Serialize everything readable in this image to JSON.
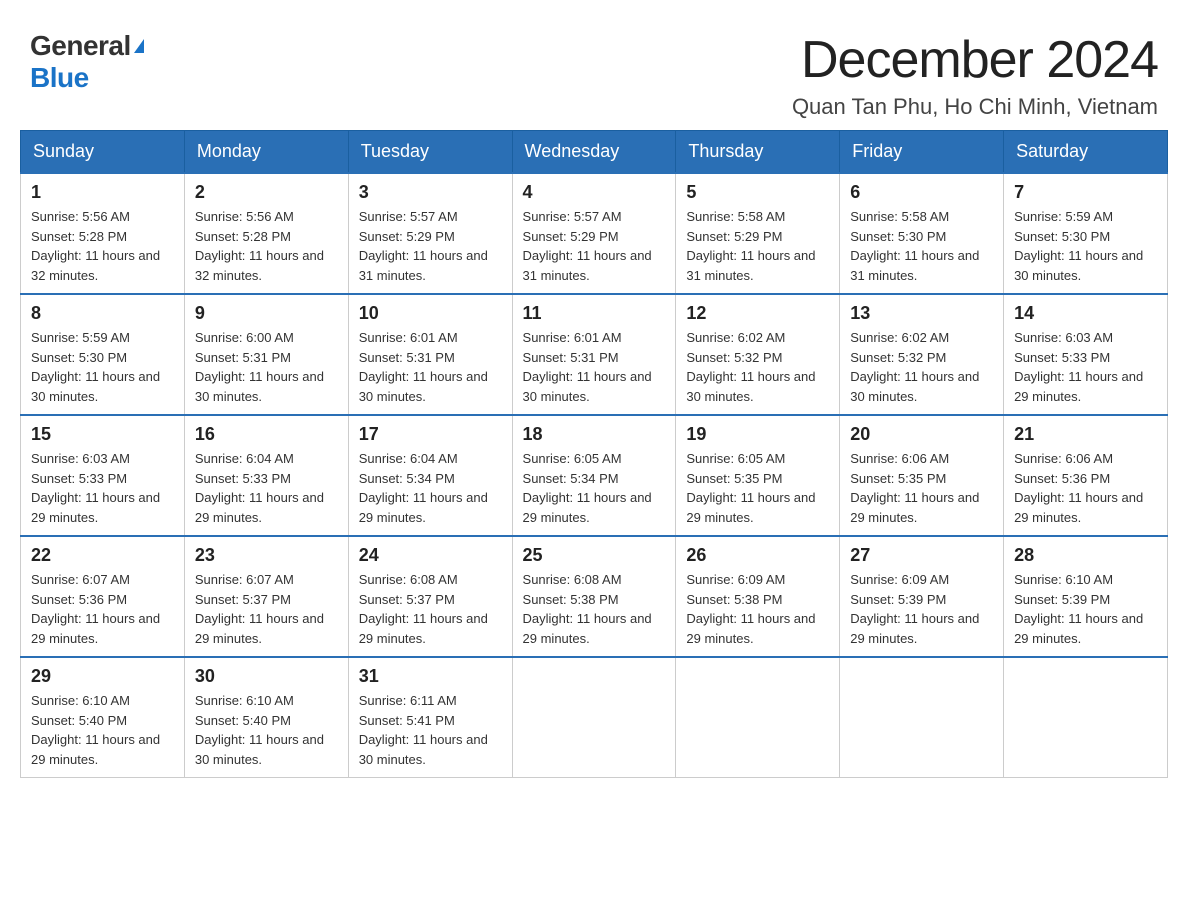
{
  "header": {
    "logo_general": "General",
    "logo_blue": "Blue",
    "title": "December 2024",
    "subtitle": "Quan Tan Phu, Ho Chi Minh, Vietnam"
  },
  "days_of_week": [
    "Sunday",
    "Monday",
    "Tuesday",
    "Wednesday",
    "Thursday",
    "Friday",
    "Saturday"
  ],
  "weeks": [
    [
      {
        "day": "1",
        "sunrise": "Sunrise: 5:56 AM",
        "sunset": "Sunset: 5:28 PM",
        "daylight": "Daylight: 11 hours and 32 minutes."
      },
      {
        "day": "2",
        "sunrise": "Sunrise: 5:56 AM",
        "sunset": "Sunset: 5:28 PM",
        "daylight": "Daylight: 11 hours and 32 minutes."
      },
      {
        "day": "3",
        "sunrise": "Sunrise: 5:57 AM",
        "sunset": "Sunset: 5:29 PM",
        "daylight": "Daylight: 11 hours and 31 minutes."
      },
      {
        "day": "4",
        "sunrise": "Sunrise: 5:57 AM",
        "sunset": "Sunset: 5:29 PM",
        "daylight": "Daylight: 11 hours and 31 minutes."
      },
      {
        "day": "5",
        "sunrise": "Sunrise: 5:58 AM",
        "sunset": "Sunset: 5:29 PM",
        "daylight": "Daylight: 11 hours and 31 minutes."
      },
      {
        "day": "6",
        "sunrise": "Sunrise: 5:58 AM",
        "sunset": "Sunset: 5:30 PM",
        "daylight": "Daylight: 11 hours and 31 minutes."
      },
      {
        "day": "7",
        "sunrise": "Sunrise: 5:59 AM",
        "sunset": "Sunset: 5:30 PM",
        "daylight": "Daylight: 11 hours and 30 minutes."
      }
    ],
    [
      {
        "day": "8",
        "sunrise": "Sunrise: 5:59 AM",
        "sunset": "Sunset: 5:30 PM",
        "daylight": "Daylight: 11 hours and 30 minutes."
      },
      {
        "day": "9",
        "sunrise": "Sunrise: 6:00 AM",
        "sunset": "Sunset: 5:31 PM",
        "daylight": "Daylight: 11 hours and 30 minutes."
      },
      {
        "day": "10",
        "sunrise": "Sunrise: 6:01 AM",
        "sunset": "Sunset: 5:31 PM",
        "daylight": "Daylight: 11 hours and 30 minutes."
      },
      {
        "day": "11",
        "sunrise": "Sunrise: 6:01 AM",
        "sunset": "Sunset: 5:31 PM",
        "daylight": "Daylight: 11 hours and 30 minutes."
      },
      {
        "day": "12",
        "sunrise": "Sunrise: 6:02 AM",
        "sunset": "Sunset: 5:32 PM",
        "daylight": "Daylight: 11 hours and 30 minutes."
      },
      {
        "day": "13",
        "sunrise": "Sunrise: 6:02 AM",
        "sunset": "Sunset: 5:32 PM",
        "daylight": "Daylight: 11 hours and 30 minutes."
      },
      {
        "day": "14",
        "sunrise": "Sunrise: 6:03 AM",
        "sunset": "Sunset: 5:33 PM",
        "daylight": "Daylight: 11 hours and 29 minutes."
      }
    ],
    [
      {
        "day": "15",
        "sunrise": "Sunrise: 6:03 AM",
        "sunset": "Sunset: 5:33 PM",
        "daylight": "Daylight: 11 hours and 29 minutes."
      },
      {
        "day": "16",
        "sunrise": "Sunrise: 6:04 AM",
        "sunset": "Sunset: 5:33 PM",
        "daylight": "Daylight: 11 hours and 29 minutes."
      },
      {
        "day": "17",
        "sunrise": "Sunrise: 6:04 AM",
        "sunset": "Sunset: 5:34 PM",
        "daylight": "Daylight: 11 hours and 29 minutes."
      },
      {
        "day": "18",
        "sunrise": "Sunrise: 6:05 AM",
        "sunset": "Sunset: 5:34 PM",
        "daylight": "Daylight: 11 hours and 29 minutes."
      },
      {
        "day": "19",
        "sunrise": "Sunrise: 6:05 AM",
        "sunset": "Sunset: 5:35 PM",
        "daylight": "Daylight: 11 hours and 29 minutes."
      },
      {
        "day": "20",
        "sunrise": "Sunrise: 6:06 AM",
        "sunset": "Sunset: 5:35 PM",
        "daylight": "Daylight: 11 hours and 29 minutes."
      },
      {
        "day": "21",
        "sunrise": "Sunrise: 6:06 AM",
        "sunset": "Sunset: 5:36 PM",
        "daylight": "Daylight: 11 hours and 29 minutes."
      }
    ],
    [
      {
        "day": "22",
        "sunrise": "Sunrise: 6:07 AM",
        "sunset": "Sunset: 5:36 PM",
        "daylight": "Daylight: 11 hours and 29 minutes."
      },
      {
        "day": "23",
        "sunrise": "Sunrise: 6:07 AM",
        "sunset": "Sunset: 5:37 PM",
        "daylight": "Daylight: 11 hours and 29 minutes."
      },
      {
        "day": "24",
        "sunrise": "Sunrise: 6:08 AM",
        "sunset": "Sunset: 5:37 PM",
        "daylight": "Daylight: 11 hours and 29 minutes."
      },
      {
        "day": "25",
        "sunrise": "Sunrise: 6:08 AM",
        "sunset": "Sunset: 5:38 PM",
        "daylight": "Daylight: 11 hours and 29 minutes."
      },
      {
        "day": "26",
        "sunrise": "Sunrise: 6:09 AM",
        "sunset": "Sunset: 5:38 PM",
        "daylight": "Daylight: 11 hours and 29 minutes."
      },
      {
        "day": "27",
        "sunrise": "Sunrise: 6:09 AM",
        "sunset": "Sunset: 5:39 PM",
        "daylight": "Daylight: 11 hours and 29 minutes."
      },
      {
        "day": "28",
        "sunrise": "Sunrise: 6:10 AM",
        "sunset": "Sunset: 5:39 PM",
        "daylight": "Daylight: 11 hours and 29 minutes."
      }
    ],
    [
      {
        "day": "29",
        "sunrise": "Sunrise: 6:10 AM",
        "sunset": "Sunset: 5:40 PM",
        "daylight": "Daylight: 11 hours and 29 minutes."
      },
      {
        "day": "30",
        "sunrise": "Sunrise: 6:10 AM",
        "sunset": "Sunset: 5:40 PM",
        "daylight": "Daylight: 11 hours and 30 minutes."
      },
      {
        "day": "31",
        "sunrise": "Sunrise: 6:11 AM",
        "sunset": "Sunset: 5:41 PM",
        "daylight": "Daylight: 11 hours and 30 minutes."
      },
      null,
      null,
      null,
      null
    ]
  ]
}
